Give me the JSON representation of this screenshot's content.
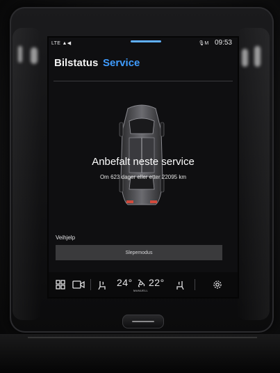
{
  "status_bar": {
    "left_text": "LTE",
    "mic_text": "M",
    "time": "09:53"
  },
  "tabs": {
    "car_status": "Bilstatus",
    "service": "Service"
  },
  "service": {
    "headline": "Anbefalt neste service",
    "detail": "Om 623 dager eller etter 22095 km"
  },
  "roadside": {
    "section_label": "Veihjelp",
    "tow_mode_button": "Slepemodus"
  },
  "climate": {
    "left_temp": "24°",
    "right_temp": "22°",
    "mode": "MANUELL"
  },
  "icons": {
    "apps": "grid-icon",
    "camera": "camera-icon",
    "left_seat": "seat-heat-icon",
    "fan": "fan-icon",
    "right_seat": "seat-heat-icon",
    "settings": "gear-icon"
  },
  "colors": {
    "accent": "#3f9cff",
    "screen_bg": "#0f0f11",
    "button_bg": "#3a3a3c"
  }
}
